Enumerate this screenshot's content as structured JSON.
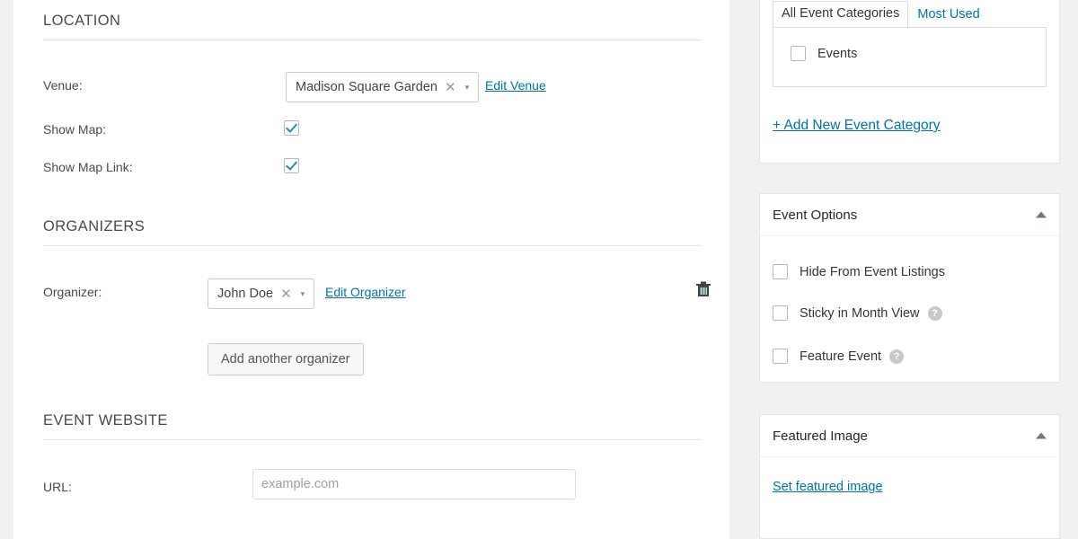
{
  "main": {
    "sections": [
      {
        "id": "location",
        "title": "LOCATION",
        "venue_label": "Venue:",
        "venue_value": "Madison Square Garden",
        "venue_clear": "✕",
        "venue_arrow": "▾",
        "edit_venue_link": "Edit Venue",
        "show_map_label": "Show Map:",
        "show_map_checked": true,
        "show_map_link_label": "Show Map Link:",
        "show_map_link_checked": true
      },
      {
        "id": "organizers",
        "title": "ORGANIZERS",
        "organizer_label": "Organizer:",
        "organizer_value": "John Doe",
        "organizer_clear": "✕",
        "organizer_arrow": "▾",
        "edit_organizer_link": "Edit Organizer",
        "delete_icon": "trash-icon",
        "add_button_label": "Add another organizer"
      },
      {
        "id": "event-website",
        "title": "EVENT WEBSITE",
        "url_label": "URL:",
        "url_value": "",
        "url_placeholder": "example.com"
      }
    ]
  },
  "sidebar": {
    "categories_box": {
      "tabs": [
        {
          "label": "All Event Categories",
          "active": true
        },
        {
          "label": "Most Used",
          "active": false
        }
      ],
      "items": [
        {
          "label": "Events",
          "checked": false
        }
      ],
      "add_link": "+ Add New Event Category"
    },
    "event_options": {
      "title": "Event Options",
      "toggle_icon": "chevron-up-icon",
      "options": [
        {
          "label": "Hide From Event Listings",
          "checked": false,
          "help": false
        },
        {
          "label": "Sticky in Month View",
          "checked": false,
          "help": true,
          "help_glyph": "?"
        },
        {
          "label": "Feature Event",
          "checked": false,
          "help": true,
          "help_glyph": "?"
        }
      ]
    },
    "featured_image": {
      "title": "Featured Image",
      "toggle_icon": "chevron-up-icon",
      "set_link": "Set featured image"
    }
  },
  "colors": {
    "accent_link": "#0073aa",
    "checkbox_tick": "#1e8cbe",
    "page_bg": "#f1f1f1",
    "panel_bg": "#ffffff",
    "border": "#e5e5e5"
  }
}
